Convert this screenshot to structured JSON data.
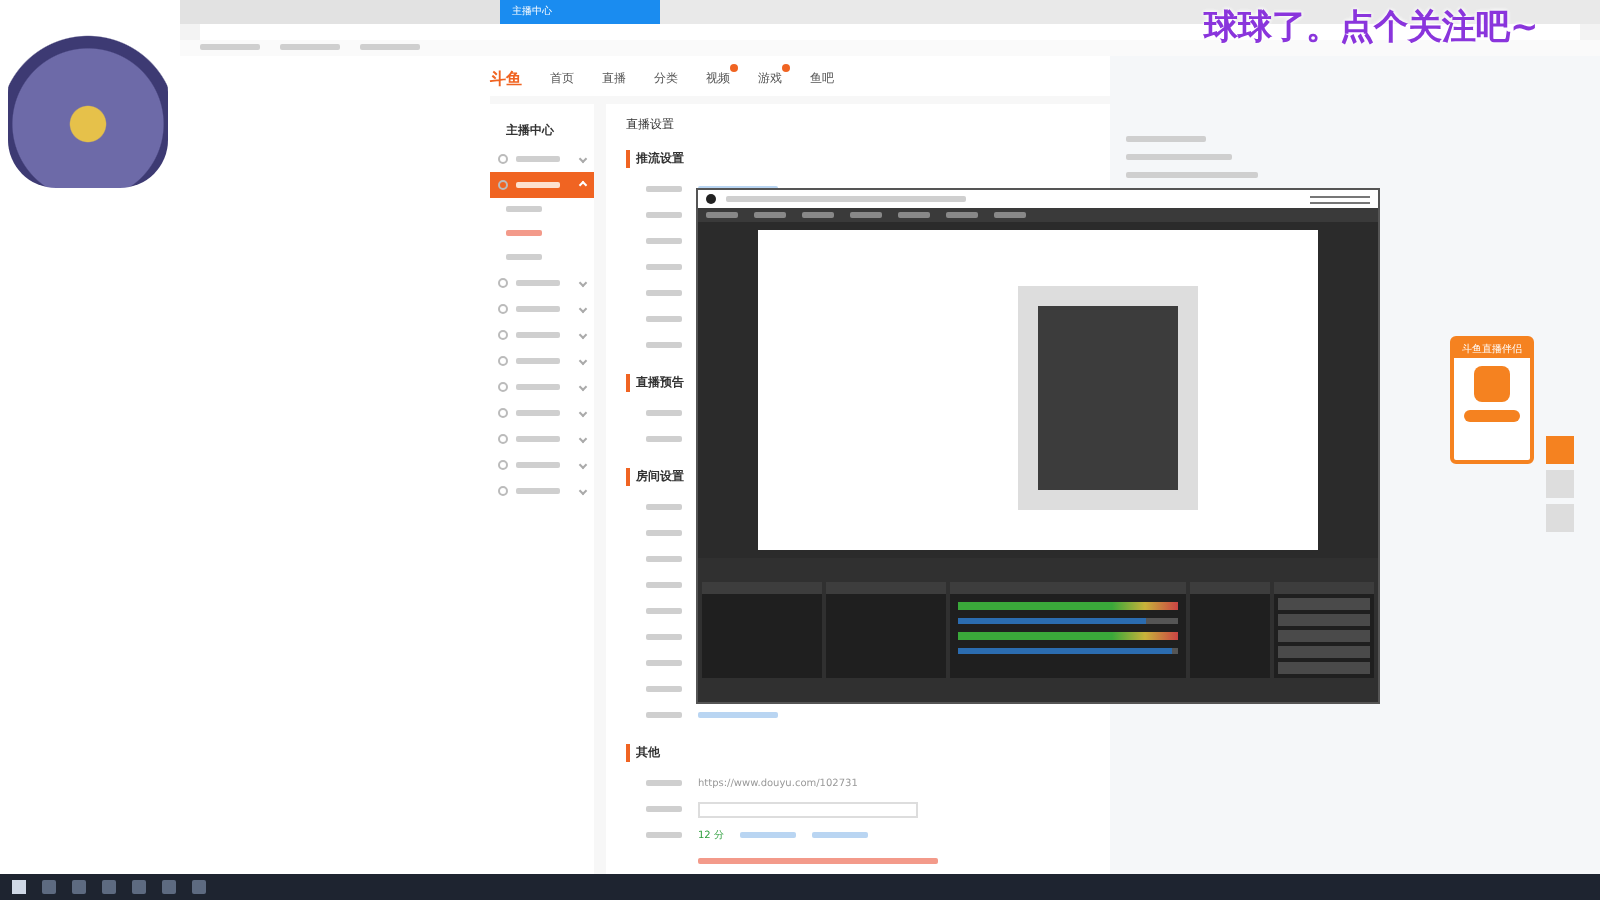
{
  "browser": {
    "tabs": [
      {
        "selected": false
      },
      {
        "selected": false
      },
      {
        "label": "主播中心",
        "selected": true
      }
    ]
  },
  "site_nav": {
    "logo": "斗鱼",
    "items": [
      {
        "label": "首页",
        "badge": false
      },
      {
        "label": "直播",
        "badge": false
      },
      {
        "label": "分类",
        "badge": false
      },
      {
        "label": "视频",
        "badge": true
      },
      {
        "label": "游戏",
        "badge": true
      },
      {
        "label": "鱼吧",
        "badge": false
      }
    ]
  },
  "sidebar": {
    "title": "主播中心",
    "items": [
      {
        "selected": false,
        "expanded": false
      },
      {
        "selected": true,
        "expanded": true,
        "children": [
          {
            "selected": false
          },
          {
            "selected": true
          },
          {
            "selected": false
          }
        ]
      },
      {
        "selected": false,
        "expanded": false
      },
      {
        "selected": false,
        "expanded": false
      },
      {
        "selected": false,
        "expanded": false
      },
      {
        "selected": false,
        "expanded": false
      },
      {
        "selected": false,
        "expanded": false
      },
      {
        "selected": false,
        "expanded": false
      },
      {
        "selected": false,
        "expanded": false
      },
      {
        "selected": false,
        "expanded": false
      },
      {
        "selected": false,
        "expanded": false
      }
    ]
  },
  "main": {
    "title": "直播设置",
    "sections": [
      {
        "heading": "推流设置"
      },
      {
        "heading": "直播预告"
      },
      {
        "heading": "房间设置"
      },
      {
        "heading": "其他",
        "room_url": "https://www.douyu.com/102731",
        "score": "12 分"
      }
    ]
  },
  "obs": {
    "mixer": [
      {
        "level": 0.85
      },
      {
        "level": 0.97
      }
    ]
  },
  "overlay": {
    "banner": "球球了。点个关注吧~"
  },
  "promo": {
    "title": "斗鱼直播伴侣"
  }
}
